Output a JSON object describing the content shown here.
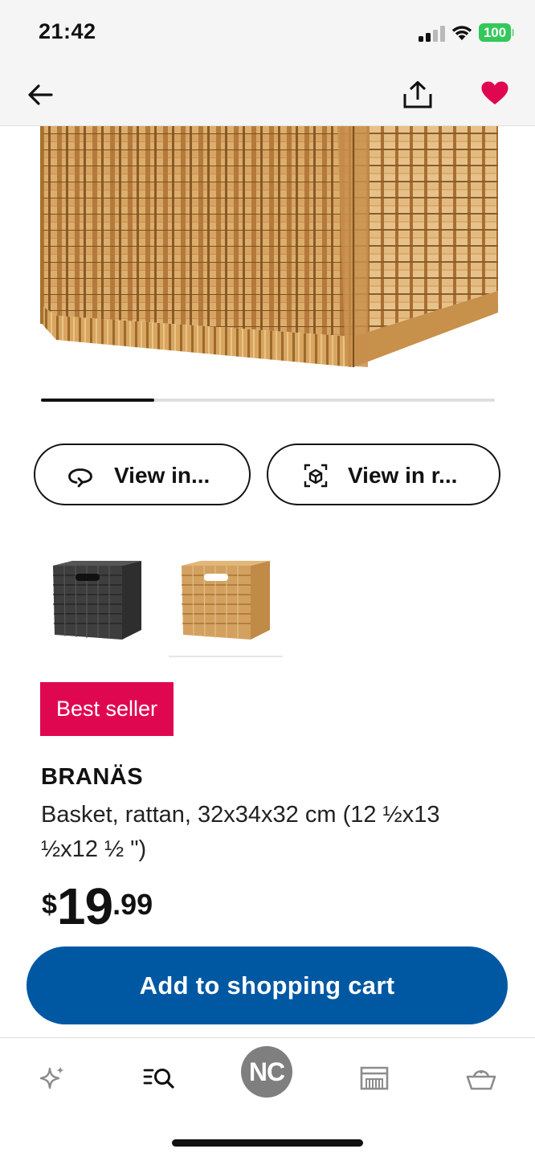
{
  "status_bar": {
    "time": "21:42",
    "battery": "100",
    "icons": [
      "signal-icon",
      "wifi-icon",
      "battery-icon"
    ]
  },
  "header": {
    "icons": [
      "back-arrow-icon",
      "share-icon",
      "heart-icon"
    ],
    "favorite_color": "#e00751"
  },
  "carousel": {
    "progress": 0.25
  },
  "view_buttons": [
    {
      "label": "View in...",
      "icon": "rotate-360-icon"
    },
    {
      "label": "View in r...",
      "icon": "ar-cube-icon"
    }
  ],
  "variants": [
    {
      "name": "dark-grey-basket",
      "selected": false,
      "color": "#4a4a4a"
    },
    {
      "name": "natural-rattan-basket",
      "selected": true,
      "color": "#c99a5c"
    }
  ],
  "badge": {
    "label": "Best seller",
    "color": "#e00751"
  },
  "product": {
    "name": "BRANÄS",
    "description": "Basket, rattan, 32x34x32 cm (12 ½x13 ½x12 ½ \")",
    "price": {
      "currency": "$",
      "integer": "19",
      "decimal": ".99"
    }
  },
  "cart": {
    "label": "Add to shopping cart",
    "color": "#0058a3"
  },
  "bottom_nav": {
    "items": [
      "sparkle-icon",
      "search-list-icon",
      "profile-avatar",
      "store-icon",
      "basket-icon"
    ],
    "avatar_initials": "NC"
  }
}
